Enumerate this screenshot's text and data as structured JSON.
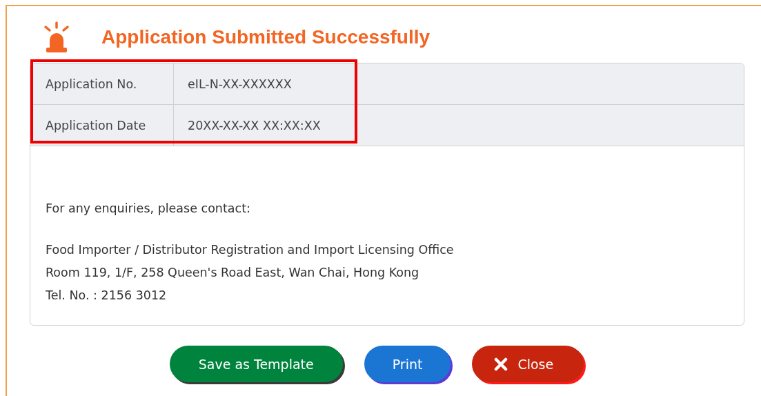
{
  "title": "Application Submitted Successfully",
  "details_highlighted": true,
  "details": [
    {
      "label": "Application No.",
      "value": "eIL-N-XX-XXXXXX"
    },
    {
      "label": "Application Date",
      "value": "20XX-XX-XX XX:XX:XX"
    }
  ],
  "enquiry_prompt": "For any enquiries, please contact:",
  "contact_lines": [
    "Food Importer / Distributor Registration and Import Licensing Office",
    "Room 119, 1/F, 258 Queen's Road East, Wan Chai, Hong Kong",
    "Tel. No. : 2156 3012"
  ],
  "buttons": [
    {
      "label": "Save as Template",
      "kind": "save"
    },
    {
      "label": "Print",
      "kind": "print"
    },
    {
      "label": "Close",
      "kind": "close"
    }
  ]
}
